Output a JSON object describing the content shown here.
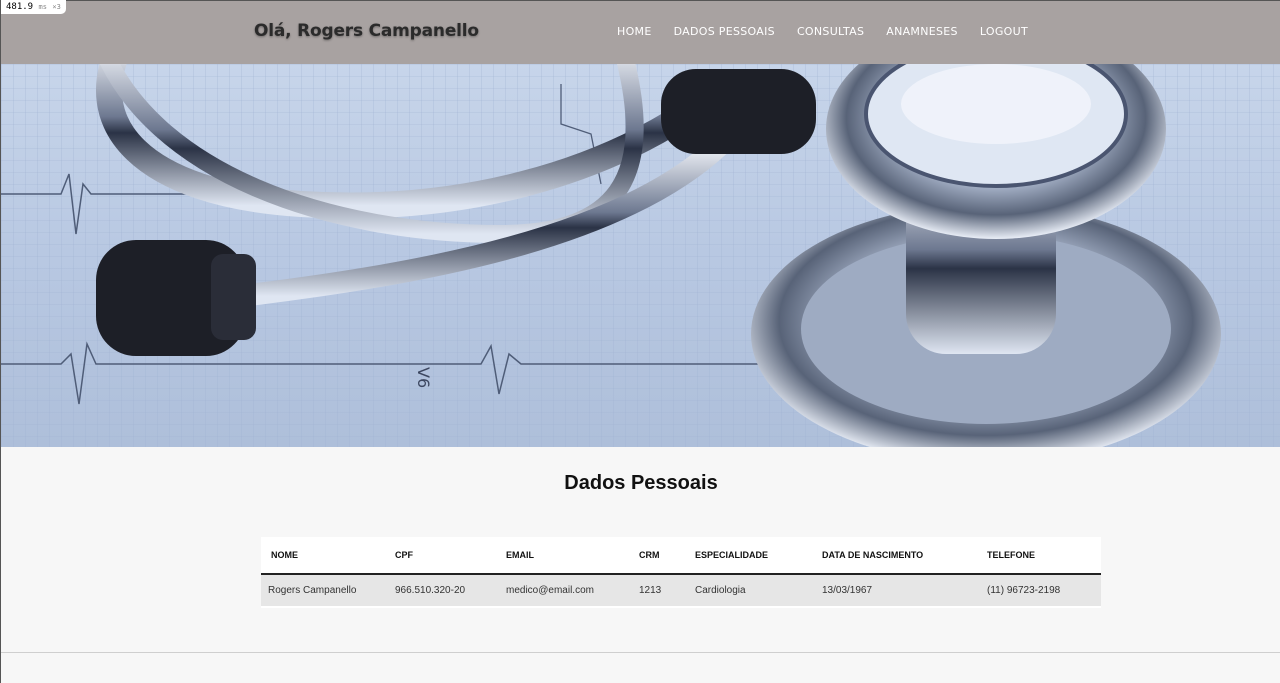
{
  "perf": {
    "value": "481.9",
    "unit": "ms",
    "mult": "×3"
  },
  "header": {
    "greeting": "Olá, Rogers Campanello"
  },
  "nav": [
    {
      "label": "HOME"
    },
    {
      "label": "DADOS PESSOAIS"
    },
    {
      "label": "CONSULTAS"
    },
    {
      "label": "ANAMNESES"
    },
    {
      "label": "LOGOUT"
    }
  ],
  "hero": {
    "ecg_label": "V6"
  },
  "main": {
    "title": "Dados Pessoais"
  },
  "table": {
    "headers": [
      "NOME",
      "CPF",
      "EMAIL",
      "CRM",
      "ESPECIALIDADE",
      "DATA DE NASCIMENTO",
      "TELEFONE"
    ],
    "rows": [
      [
        "Rogers Campanello",
        "966.510.320-20",
        "medico@email.com",
        "1213",
        "Cardiologia",
        "13/03/1967",
        "(11) 96723-2198"
      ]
    ]
  },
  "colors": {
    "navbar": "#a8a2a1",
    "hero_tint": "#b8c8e2",
    "row_bg": "#e6e6e6"
  }
}
